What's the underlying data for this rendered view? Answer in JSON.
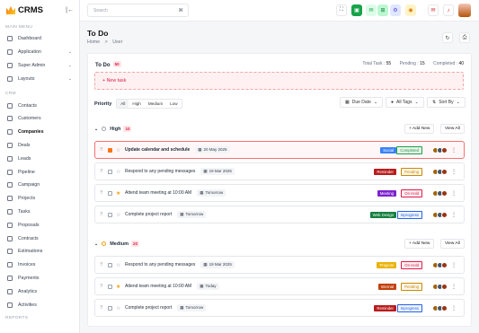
{
  "app": {
    "name": "CRMS"
  },
  "sidebar": {
    "main_menu": "MAIN MENU",
    "crm_label": "CRM",
    "reports_label": "REPORTS",
    "main": [
      {
        "label": "Dashboard"
      },
      {
        "label": "Application",
        "chev": "⌄"
      },
      {
        "label": "Super Admin",
        "chev": "⌄"
      },
      {
        "label": "Layouts",
        "chev": "⌄"
      }
    ],
    "crm": [
      {
        "label": "Contacts"
      },
      {
        "label": "Customers"
      },
      {
        "label": "Companies"
      },
      {
        "label": "Deals"
      },
      {
        "label": "Leads"
      },
      {
        "label": "Pipeline"
      },
      {
        "label": "Campaign"
      },
      {
        "label": "Projects"
      },
      {
        "label": "Tasks"
      },
      {
        "label": "Proposals"
      },
      {
        "label": "Contracts"
      },
      {
        "label": "Estimations"
      },
      {
        "label": "Invoices"
      },
      {
        "label": "Payments"
      },
      {
        "label": "Analytics"
      },
      {
        "label": "Activities"
      }
    ]
  },
  "topbar": {
    "search_placeholder": "Search",
    "search_key": "⌘"
  },
  "page": {
    "title": "To Do",
    "breadcrumb_home": "Home",
    "breadcrumb_sep": ">",
    "breadcrumb_current": "User"
  },
  "todo": {
    "title": "To Do",
    "count": "50",
    "total_label": "Total Task :",
    "total": "55",
    "pending_label": "Pending :",
    "pending": "15",
    "completed_label": "Completed :",
    "completed": "40"
  },
  "new_task": "+ New task",
  "filters": {
    "priority_label": "Priority",
    "priorities": [
      "All",
      "High",
      "Medium",
      "Low"
    ],
    "due_date": "Due Date",
    "all_tags": "All Tags",
    "sort_by": "Sort By"
  },
  "groups": [
    {
      "name": "High",
      "count": "10",
      "add_new": "+ Add New",
      "view_all": "View All",
      "tasks": [
        {
          "title": "Update calendar and schedule",
          "date": "20 May 2025",
          "tag": "Social",
          "tag_color": "#3b82f6",
          "status": "Completed",
          "status_color": "#16a34a",
          "starred": false,
          "selected": true
        },
        {
          "title": "Respond to any pending messages",
          "date": "19 Mar 2025",
          "tag": "Reminder",
          "tag_color": "#b91c1c",
          "status": "Pending",
          "status_color": "#ca8a04",
          "starred": false,
          "selected": false
        },
        {
          "title": "Attend team meeting at 10:00 AM",
          "date": "Tomorrow",
          "tag": "Meeting",
          "tag_color": "#7e22ce",
          "status": "On Hold",
          "status_color": "#e11d48",
          "starred": true,
          "selected": false
        },
        {
          "title": "Complete project report",
          "date": "Tomorrow",
          "tag": "Web Design",
          "tag_color": "#15803d",
          "status": "Inprogress",
          "status_color": "#2563eb",
          "starred": false,
          "selected": false
        }
      ]
    },
    {
      "name": "Medium",
      "count": "20",
      "add_new": "+ Add New",
      "view_all": "View All",
      "tasks": [
        {
          "title": "Respond to any pending messages",
          "date": "19 Mar 2025",
          "tag": "Projects",
          "tag_color": "#eab308",
          "status": "On Hold",
          "status_color": "#e11d48",
          "starred": false,
          "selected": false
        },
        {
          "title": "Attend team meeting at 10:00 AM",
          "date": "Today",
          "tag": "Internal",
          "tag_color": "#c2410c",
          "status": "Pending",
          "status_color": "#ca8a04",
          "starred": true,
          "selected": false
        },
        {
          "title": "Complete project report",
          "date": "Tomorrow",
          "tag": "Reminder",
          "tag_color": "#b91c1c",
          "status": "Inprogress",
          "status_color": "#2563eb",
          "starred": false,
          "selected": false
        }
      ]
    }
  ]
}
